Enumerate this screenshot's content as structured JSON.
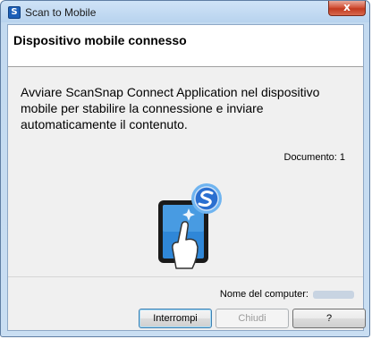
{
  "window": {
    "title": "Scan to Mobile",
    "app_icon_glyph": "S",
    "close_glyph": "x"
  },
  "header": {
    "title": "Dispositivo mobile connesso"
  },
  "main": {
    "message": "Avviare ScanSnap Connect Application nel dispositivo mobile per stabilire la connessione e inviare automaticamente il contenuto.",
    "document_label": "Documento:",
    "document_count": "1",
    "illustration_icon": "tablet-touch-scansnap-icon"
  },
  "footer": {
    "computer_label": "Nome del computer:",
    "buttons": {
      "stop": "Interrompi",
      "close": "Chiudi",
      "help": "?"
    }
  },
  "colors": {
    "accent": "#1c5fb8",
    "close_red": "#c23a1f"
  }
}
